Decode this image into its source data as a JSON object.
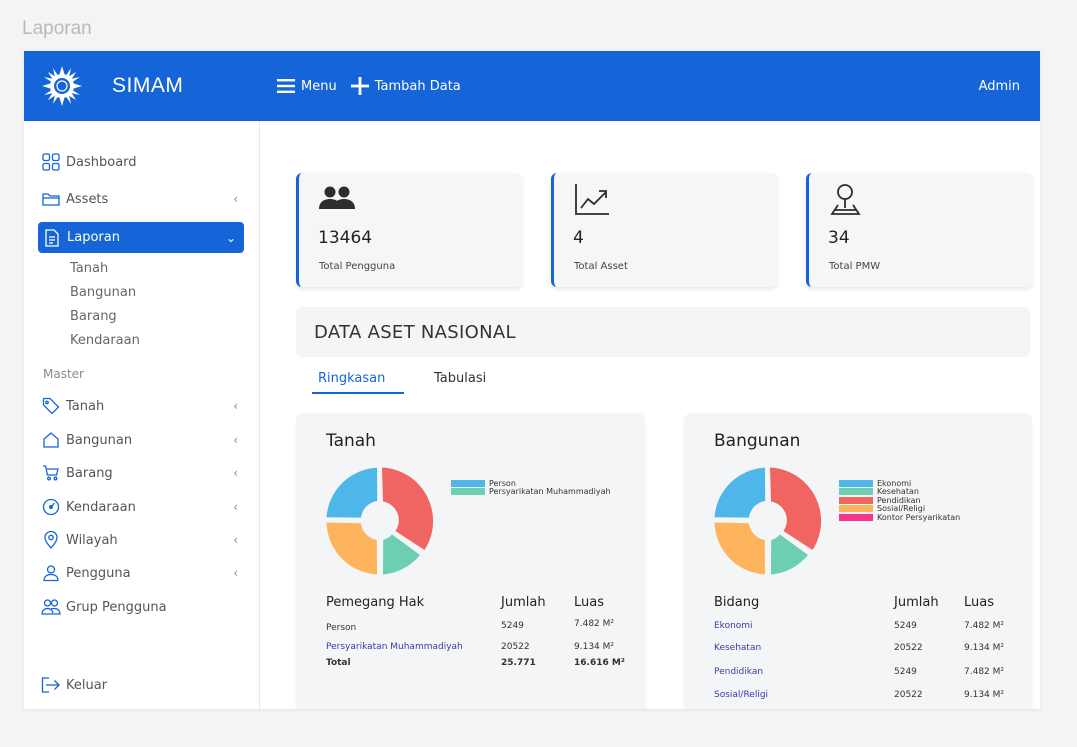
{
  "window_title": "Laporan",
  "app": {
    "name": "SIMAM"
  },
  "topbar": {
    "menu_label": "Menu",
    "add_label": "Tambah Data",
    "user_label": "Admin"
  },
  "sidebar": {
    "dashboard": "Dashboard",
    "assets": "Assets",
    "laporan": "Laporan",
    "laporan_sub": [
      "Tanah",
      "Bangunan",
      "Barang",
      "Kendaraan"
    ],
    "master_heading": "Master",
    "master_items": [
      "Tanah",
      "Bangunan",
      "Barang",
      "Kendaraan",
      "Wilayah",
      "Pengguna"
    ],
    "grup_pengguna": "Grup Pengguna",
    "logout": "Keluar",
    "chevron_collapsed": "‹",
    "chevron_expanded": "⌄"
  },
  "stats": [
    {
      "value": "13464",
      "label": "Total Pengguna",
      "icon": "users-icon"
    },
    {
      "value": "4",
      "label": "Total Asset",
      "icon": "chart-up-icon"
    },
    {
      "value": "34",
      "label": "Total PMW",
      "icon": "map-pin-icon"
    }
  ],
  "section_title": "DATA ASET NASIONAL",
  "tabs": [
    "Ringkasan",
    "Tabulasi"
  ],
  "colors": {
    "primary": "#1565d8",
    "blue": "#4fb6ea",
    "teal": "#6ccfb1",
    "red": "#f06461",
    "orange": "#fdb45c",
    "pink": "#f7358f"
  },
  "tanah": {
    "title": "Tanah",
    "legend": [
      {
        "label": "Person",
        "color": "#4fb6ea"
      },
      {
        "label": "Persyarikatan Muhammadiyah",
        "color": "#6ccfb1"
      }
    ],
    "headers": [
      "Pemegang Hak",
      "Jumlah",
      "Luas"
    ],
    "rows": [
      {
        "name": "Person",
        "jumlah": "5249",
        "luas": "7.482 M²"
      },
      {
        "name": "Persyarikatan Muhammadiyah",
        "jumlah": "20522",
        "luas": "9.134 M²"
      }
    ],
    "total": {
      "name": "Total",
      "jumlah": "25.771",
      "luas": "16.616 M²"
    }
  },
  "bangunan": {
    "title": "Bangunan",
    "legend": [
      {
        "label": "Ekonomi",
        "color": "#4fb6ea"
      },
      {
        "label": "Kesehatan",
        "color": "#6ccfb1"
      },
      {
        "label": "Pendidikan",
        "color": "#f06461"
      },
      {
        "label": "Sosial/Religi",
        "color": "#fdb45c"
      },
      {
        "label": "Kontor Persyarikatan",
        "color": "#f7358f"
      }
    ],
    "headers": [
      "Bidang",
      "Jumlah",
      "Luas"
    ],
    "rows": [
      {
        "name": "Ekonomi",
        "jumlah": "5249",
        "luas": "7.482 M²"
      },
      {
        "name": "Kesehatan",
        "jumlah": "20522",
        "luas": "9.134 M²"
      },
      {
        "name": "Pendidikan",
        "jumlah": "5249",
        "luas": "7.482 M²"
      },
      {
        "name": "Sosial/Religi",
        "jumlah": "20522",
        "luas": "9.134 M²"
      }
    ]
  }
}
